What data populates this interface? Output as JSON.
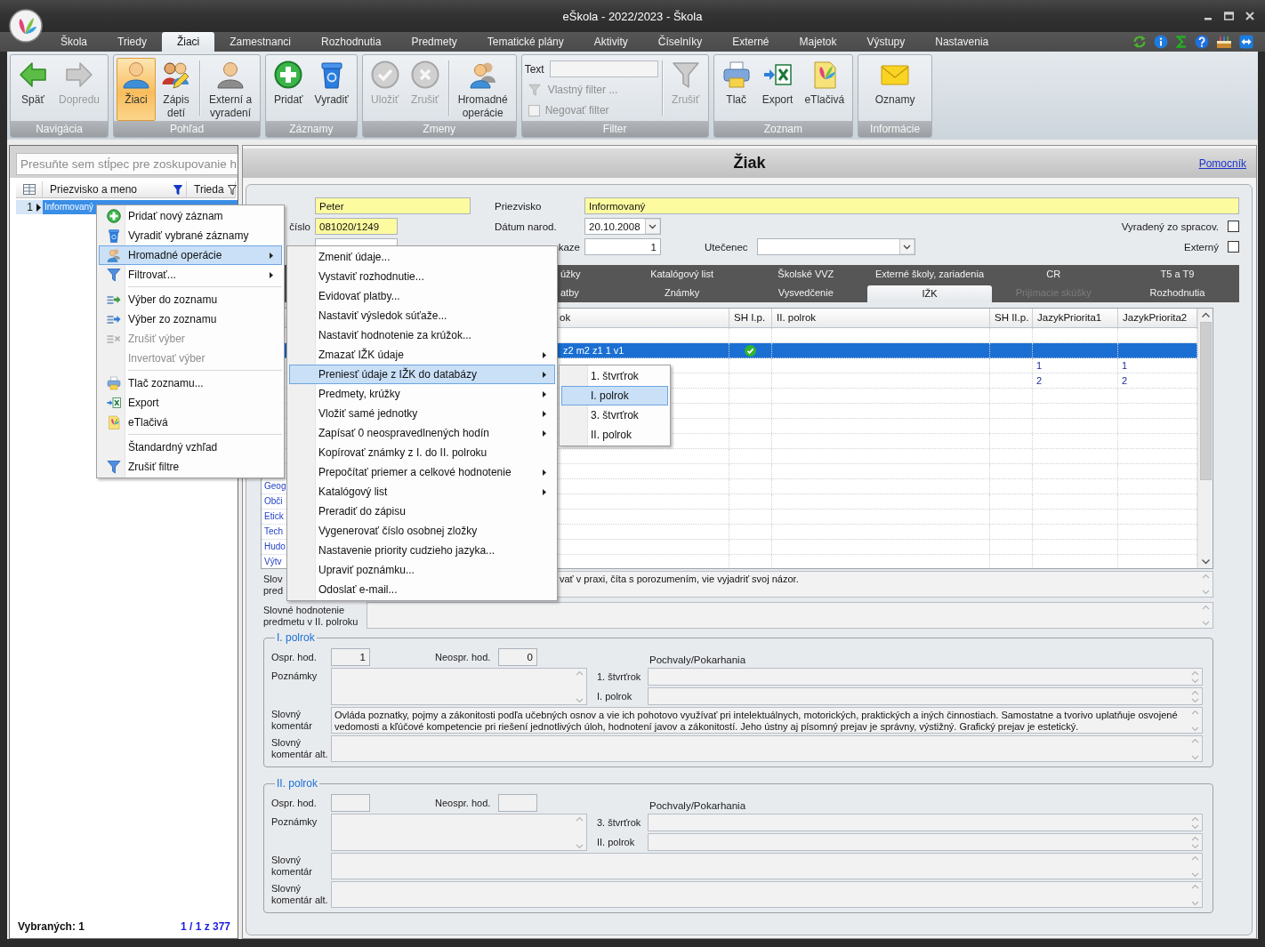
{
  "window": {
    "title": "eŠkola - 2022/2023 - Škola"
  },
  "menu_tabs": [
    {
      "label": "Škola",
      "selected": false
    },
    {
      "label": "Triedy",
      "selected": false
    },
    {
      "label": "Žiaci",
      "selected": true
    },
    {
      "label": "Zamestnanci",
      "selected": false
    },
    {
      "label": "Rozhodnutia",
      "selected": false
    },
    {
      "label": "Predmety",
      "selected": false
    },
    {
      "label": "Tematické plány",
      "selected": false
    },
    {
      "label": "Aktivity",
      "selected": false
    },
    {
      "label": "Číselníky",
      "selected": false
    },
    {
      "label": "Externé",
      "selected": false
    },
    {
      "label": "Majetok",
      "selected": false
    },
    {
      "label": "Výstupy",
      "selected": false
    },
    {
      "label": "Nastavenia",
      "selected": false
    }
  ],
  "ribbon": [
    {
      "title": "Navigácia",
      "sections": [
        [
          {
            "kind": "back",
            "label": "Späť",
            "disabled": false
          },
          {
            "kind": "forward",
            "label": "Dopredu",
            "disabled": true
          }
        ]
      ]
    },
    {
      "title": "Pohľad",
      "sections": [
        [
          {
            "kind": "student",
            "label": "Žiaci",
            "selected": true,
            "disabled": false
          },
          {
            "kind": "enroll",
            "label": "Zápis\ndetí",
            "selected": false,
            "disabled": false
          }
        ],
        [
          {
            "kind": "person",
            "label": "Externí a\nvyradení",
            "selected": false,
            "disabled": false
          }
        ]
      ]
    },
    {
      "title": "Záznamy",
      "sections": [
        [
          {
            "kind": "add",
            "label": "Pridať",
            "disabled": false
          },
          {
            "kind": "bin",
            "label": "Vyradiť",
            "disabled": false
          }
        ]
      ]
    },
    {
      "title": "Zmeny",
      "sections": [
        [
          {
            "kind": "save",
            "label": "Uložiť",
            "disabled": true
          },
          {
            "kind": "cancel",
            "label": "Zrušiť",
            "disabled": true
          }
        ],
        [
          {
            "kind": "group",
            "label": "Hromadné\noperácie",
            "disabled": false
          }
        ]
      ]
    },
    {
      "title": "Filter",
      "filter": {
        "label": "Text",
        "custom": {
          "label": "Vlastný filter ...",
          "disabled": true
        },
        "negate": {
          "label": "Negovať filter",
          "checked": false,
          "disabled": true
        }
      },
      "sections": [
        [
          {
            "kind": "funnel",
            "label": "Zrušiť",
            "disabled": true
          }
        ]
      ]
    },
    {
      "title": "Zoznam",
      "sections": [
        [
          {
            "kind": "print",
            "label": "Tlač",
            "disabled": false
          },
          {
            "kind": "export",
            "label": "Export",
            "disabled": false
          },
          {
            "kind": "forms",
            "label": "eTlačivá",
            "disabled": false
          }
        ]
      ]
    },
    {
      "title": "Informácie",
      "sections": [
        [
          {
            "kind": "mail",
            "label": "Oznamy",
            "disabled": false
          }
        ]
      ]
    }
  ],
  "list_panel": {
    "group_hint": "Presuňte sem stĺpec pre zoskupovanie h",
    "columns": [
      {
        "label": "Priezvisko a meno",
        "filtered": true
      },
      {
        "label": "Trieda",
        "filtered": false
      }
    ],
    "rows": [
      {
        "number": "1",
        "name": "Informovaný",
        "selected": true
      }
    ],
    "selected_count": "Vybraných: 1",
    "position": "1 / 1 z 377"
  },
  "detail": {
    "title": "Žiak",
    "help_link": "Pomocník",
    "form": {
      "first_name": {
        "value": "Peter",
        "required": true
      },
      "surname": {
        "label": "Priezvisko",
        "value": "Informovaný",
        "required": true
      },
      "birth_number": {
        "label": "číslo",
        "value": "081020/1249",
        "required": true
      },
      "birth_date": {
        "label": "Dátum narod.",
        "value": "20.10.2008",
        "required": false
      },
      "discarded": {
        "label": "Vyradený zo spracov.",
        "checked": false
      },
      "class_number": {
        "label": "kaze",
        "value": "1",
        "required": false
      },
      "refugee": {
        "label": "Utečenec"
      },
      "external": {
        "label": "Externý",
        "checked": false
      }
    },
    "tabs": [
      [
        {
          "label": "úžky",
          "selected": false,
          "disabled": false
        },
        {
          "label": "Katalógový list",
          "selected": false,
          "disabled": false
        },
        {
          "label": "Školské VVZ",
          "selected": false,
          "disabled": false
        },
        {
          "label": "Externé školy, zariadenia",
          "selected": false,
          "disabled": false
        },
        {
          "label": "CR",
          "selected": false,
          "disabled": false
        },
        {
          "label": "T5 a T9",
          "selected": false,
          "disabled": false
        }
      ],
      [
        {
          "label": "atby",
          "selected": false,
          "disabled": false
        },
        {
          "label": "Známky",
          "selected": false,
          "disabled": false
        },
        {
          "label": "Vysvedčenie",
          "selected": false,
          "disabled": false
        },
        {
          "label": "IŽK",
          "selected": true,
          "disabled": false
        },
        {
          "label": "Prijímacie skúšky",
          "selected": false,
          "disabled": true
        },
        {
          "label": "Rozhodnutia",
          "selected": false,
          "disabled": false
        }
      ]
    ],
    "grid": {
      "columns": [
        "ok",
        "SH I.p.",
        "II. polrok",
        "SH II.p.",
        "JazykPriorita1",
        "JazykPriorita2"
      ],
      "rows": [
        {
          "selected": false,
          "sh_1": false
        },
        {
          "term_1": "z2 m2 z1 1 v1",
          "selected": true,
          "sh_1": true
        },
        {
          "lang_1": "1",
          "lang_2": "1",
          "selected": false,
          "sh_1": false
        },
        {
          "lang_1": "2",
          "lang_2": "2",
          "selected": false,
          "sh_1": false
        },
        {
          "selected": false,
          "sh_1": false
        },
        {
          "selected": false,
          "sh_1": false
        },
        {
          "selected": false,
          "sh_1": false
        },
        {
          "selected": false,
          "sh_1": false
        },
        {
          "selected": false,
          "sh_1": false
        },
        {
          "selected": false,
          "sh_1": false
        },
        {
          "subject": "Geog",
          "selected": false,
          "sh_1": false
        },
        {
          "subject": "Obči",
          "selected": false,
          "sh_1": false
        },
        {
          "subject": "Etick",
          "selected": false,
          "sh_1": false
        },
        {
          "subject": "Tech",
          "selected": false,
          "sh_1": false
        },
        {
          "subject": "Hudo",
          "selected": false,
          "sh_1": false
        },
        {
          "subject": "Výtv",
          "selected": false,
          "sh_1": false
        }
      ]
    },
    "evaluation": [
      {
        "label": "Slov\npred",
        "value": "vať v praxi, číta s porozumením, vie vyjadriť svoj názor."
      },
      {
        "label": "Slovné hodnotenie predmetu v II. polroku"
      }
    ],
    "terms": [
      {
        "title": "I. polrok",
        "excused": {
          "label": "Ospr. hod.",
          "value": "1"
        },
        "unexcused": {
          "label": "Neospr. hod.",
          "value": "0"
        },
        "notes": {
          "label": "Poznámky"
        },
        "commendations": {
          "title": "Pochvaly/Pokarhania",
          "fields": [
            {
              "label": "1. štvrťrok"
            },
            {
              "label": "I. polrok"
            }
          ]
        },
        "comment": {
          "label": "Slovný komentár",
          "value": "Ovláda poznatky, pojmy a zákonitosti podľa učebných osnov a vie ich pohotovo využívať pri intelektuálnych, motorických, praktických a iných činnostiach. Samostatne a tvorivo uplatňuje osvojené vedomosti a kľúčové kompetencie pri riešení jednotlivých úloh, hodnotení javov a zákonitostí. Jeho ústny aj písomný prejav je správny, výstižný. Grafický prejav je estetický."
        },
        "comment_alt": {
          "label": "Slovný komentár alt."
        }
      },
      {
        "title": "II. polrok",
        "excused": {
          "label": "Ospr. hod."
        },
        "unexcused": {
          "label": "Neospr. hod."
        },
        "notes": {
          "label": "Poznámky"
        },
        "commendations": {
          "title": "Pochvaly/Pokarhania",
          "fields": [
            {
              "label": "3. štvrťrok"
            },
            {
              "label": "II. polrok"
            }
          ]
        },
        "comment": {
          "label": "Slovný komentár"
        },
        "comment_alt": {
          "label": "Slovný komentár alt."
        }
      }
    ]
  },
  "menus": [
    {
      "sections": [
        [
          {
            "kind": "add",
            "label": "Pridať nový záznam",
            "selected": false,
            "disabled": false,
            "submenu": false
          },
          {
            "kind": "bin",
            "label": "Vyradiť vybrané záznamy",
            "selected": false,
            "disabled": false,
            "submenu": false
          },
          {
            "kind": "group",
            "label": "Hromadné operácie",
            "selected": true,
            "disabled": false,
            "submenu": true
          },
          {
            "kind": "funnel",
            "label": "Filtrovať...",
            "selected": false,
            "disabled": false,
            "submenu": true
          }
        ],
        [
          {
            "kind": "list_add",
            "label": "Výber do zoznamu",
            "selected": false,
            "disabled": false,
            "submenu": false
          },
          {
            "kind": "list_remove",
            "label": "Výber zo zoznamu",
            "selected": false,
            "disabled": false,
            "submenu": false
          },
          {
            "kind": "list_clear",
            "label": "Zrušiť výber",
            "selected": false,
            "disabled": true,
            "submenu": false
          },
          {
            "kind": "none",
            "label": "Invertovať výber",
            "selected": false,
            "disabled": true,
            "submenu": false
          }
        ],
        [
          {
            "kind": "print",
            "label": "Tlač zoznamu...",
            "selected": false,
            "disabled": false,
            "submenu": false
          },
          {
            "kind": "export",
            "label": "Export",
            "selected": false,
            "disabled": false,
            "submenu": false
          },
          {
            "kind": "forms",
            "label": "eTlačivá",
            "selected": false,
            "disabled": false,
            "submenu": false
          }
        ],
        [
          {
            "kind": "none",
            "label": "Štandardný vzhľad",
            "selected": false,
            "disabled": false,
            "submenu": false
          },
          {
            "kind": "funnel",
            "label": "Zrušiť filtre",
            "selected": false,
            "disabled": false,
            "submenu": false
          }
        ]
      ]
    },
    {
      "sections": [
        [
          {
            "label": "Zmeniť údaje...",
            "selected": false,
            "submenu": false
          },
          {
            "label": "Vystaviť rozhodnutie...",
            "selected": false,
            "submenu": false
          },
          {
            "label": "Evidovať platby...",
            "selected": false,
            "submenu": false
          },
          {
            "label": "Nastaviť výsledok súťaže...",
            "selected": false,
            "submenu": false
          },
          {
            "label": "Nastaviť hodnotenie za krúžok...",
            "selected": false,
            "submenu": false
          },
          {
            "label": "Zmazať IŽK údaje",
            "selected": false,
            "submenu": true
          },
          {
            "label": "Preniesť údaje z IŽK do databázy",
            "selected": true,
            "submenu": true
          },
          {
            "label": "Predmety, krúžky",
            "selected": false,
            "submenu": true
          },
          {
            "label": "Vložiť samé jednotky",
            "selected": false,
            "submenu": true
          },
          {
            "label": "Zapísať 0 neospravedlnených hodín",
            "selected": false,
            "submenu": true
          },
          {
            "label": "Kopírovať známky z I. do II. polroku",
            "selected": false,
            "submenu": false
          },
          {
            "label": "Prepočítať priemer a celkové hodnotenie",
            "selected": false,
            "submenu": true
          },
          {
            "label": "Katalógový list",
            "selected": false,
            "submenu": true
          },
          {
            "label": "Preradiť do zápisu",
            "selected": false,
            "submenu": false
          },
          {
            "label": "Vygenerovať číslo osobnej zložky",
            "selected": false,
            "submenu": false
          },
          {
            "label": "Nastavenie priority cudzieho jazyka...",
            "selected": false,
            "submenu": false
          },
          {
            "label": "Upraviť poznámku...",
            "selected": false,
            "submenu": false
          },
          {
            "label": "Odoslať e-mail...",
            "selected": false,
            "submenu": false
          }
        ]
      ]
    },
    {
      "sections": [
        [
          {
            "label": "1. štvrťrok",
            "selected": false
          },
          {
            "label": "I. polrok",
            "selected": true
          },
          {
            "label": "3. štvrťrok",
            "selected": false
          },
          {
            "label": "II. polrok",
            "selected": false
          }
        ]
      ]
    }
  ]
}
